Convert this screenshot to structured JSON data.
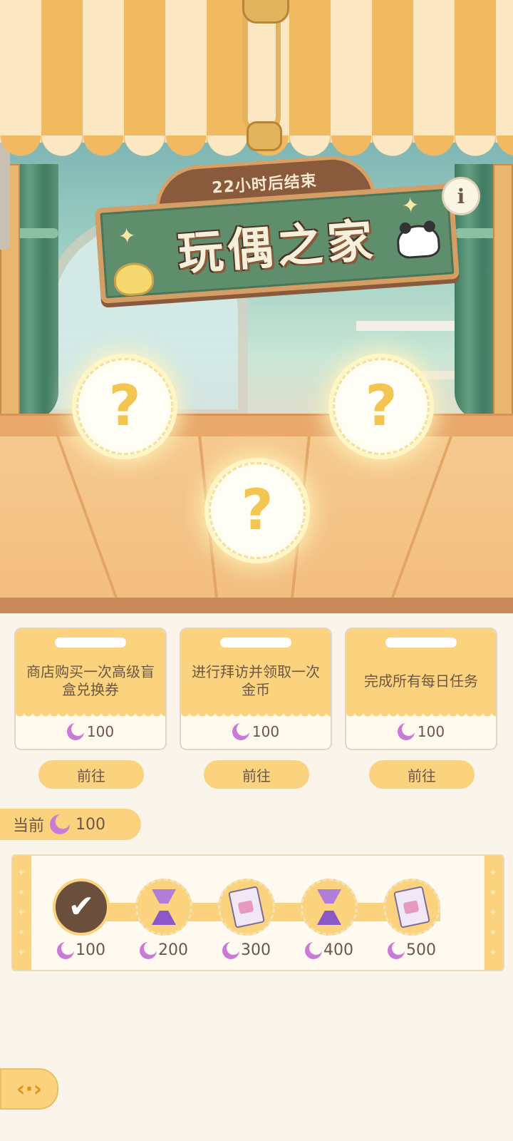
{
  "event": {
    "countdown": "22小时后结束",
    "title": "玩偶之家"
  },
  "icons": {
    "info": "info-icon",
    "mystery": "question-mark-icon",
    "currency": "moon-icon",
    "back": "back-arrow-icon",
    "check": "check-icon",
    "hourglass": "hourglass-icon",
    "ticket": "ticket-icon"
  },
  "mystery_slots": [
    "?",
    "?",
    "?"
  ],
  "tasks": [
    {
      "text": "商店购买一次高级盲盒兑换券",
      "reward": "100",
      "button": "前往"
    },
    {
      "text": "进行拜访并领取一次金币",
      "reward": "100",
      "button": "前往"
    },
    {
      "text": "完成所有每日任务",
      "reward": "100",
      "button": "前往"
    }
  ],
  "current": {
    "label": "当前",
    "value": "100"
  },
  "milestones": [
    {
      "value": "100",
      "item": "check",
      "claimed": true
    },
    {
      "value": "200",
      "item": "hourglass",
      "claimed": false
    },
    {
      "value": "300",
      "item": "ticket",
      "claimed": false
    },
    {
      "value": "400",
      "item": "hourglass",
      "claimed": false
    },
    {
      "value": "500",
      "item": "ticket",
      "claimed": false
    }
  ],
  "colors": {
    "accent": "#fbd37e",
    "text": "#6c5747",
    "currency": "#c97ad7",
    "sign_board": "#5f8e6c"
  }
}
